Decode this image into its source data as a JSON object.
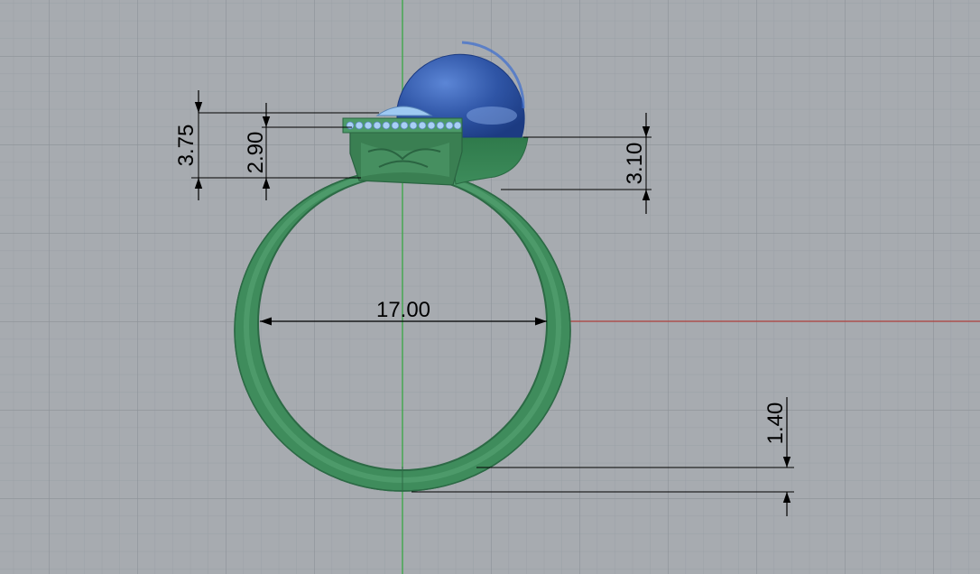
{
  "viewport": {
    "background": "#a7abb0",
    "grid_color": "#9599a0",
    "x_axis_color": "#b0403c",
    "y_axis_color": "#39a845"
  },
  "model": {
    "band_color": "#3e8a5a",
    "band_highlight": "#6fb58a",
    "head_color": "#3a7f52",
    "pearl_color": "#2f55a6",
    "pearl_highlight": "#7fa3e0",
    "diamond_color": "#9ec9f2"
  },
  "dimensions": {
    "inner_diameter": "17.00",
    "head_height_total": "3.75",
    "head_height_inner": "2.90",
    "pearl_cup_height": "3.10",
    "band_thickness": "1.40"
  }
}
